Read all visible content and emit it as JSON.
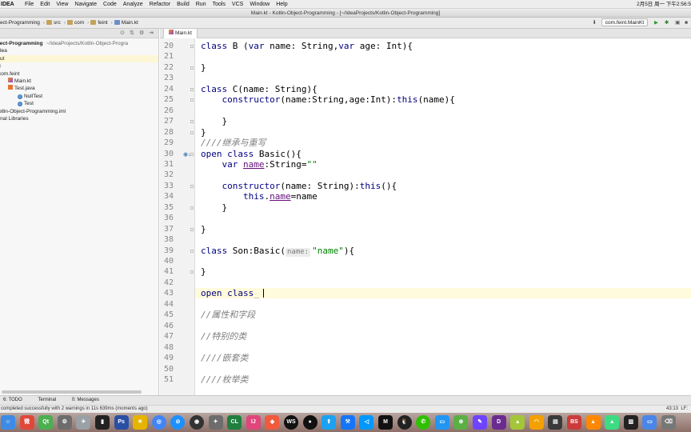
{
  "menubar": {
    "app": "IDEA",
    "items": [
      "File",
      "Edit",
      "View",
      "Navigate",
      "Code",
      "Analyze",
      "Refactor",
      "Build",
      "Run",
      "Tools",
      "VCS",
      "Window",
      "Help"
    ],
    "clock": "2月5日 周一 下午2:56:5"
  },
  "window": {
    "title": "Main.kt - Kotlin-Object-Programming - [~/IdeaProjects/Kotlin-Object-Programming]"
  },
  "navbar": {
    "crumbs": [
      "ect-Programming",
      "src",
      "com",
      "feint",
      "Main.kt"
    ],
    "run_config": "com.feint.MainKt"
  },
  "project": {
    "items": [
      {
        "label": "ject-Programming",
        "extra": "~/IdeaProjects/Kotlin-Object-Progra",
        "kind": "root",
        "bold": true
      },
      {
        "label": "dea",
        "kind": "folder"
      },
      {
        "label": "ut",
        "kind": "folder",
        "selected": true
      },
      {
        "label": "c",
        "kind": "folder"
      },
      {
        "label": "com.feint",
        "kind": "package"
      },
      {
        "label": "Main.kt",
        "kind": "kotlin"
      },
      {
        "label": "Test.java",
        "kind": "java"
      },
      {
        "label": "NullTest",
        "kind": "class"
      },
      {
        "label": "Test",
        "kind": "class"
      },
      {
        "label": "otlin-Object-Programming.iml",
        "kind": "file"
      },
      {
        "label": "rnal Libraries",
        "kind": "lib"
      }
    ]
  },
  "editor": {
    "tab": "Main.kt",
    "current_line": 43,
    "lines": [
      {
        "n": 20,
        "code": [
          {
            "t": "class ",
            "c": "kw"
          },
          {
            "t": "B ("
          },
          {
            "t": "var ",
            "c": "kw"
          },
          {
            "t": "name: String,"
          },
          {
            "t": "var ",
            "c": "kw"
          },
          {
            "t": "age: Int){"
          }
        ]
      },
      {
        "n": 21,
        "code": []
      },
      {
        "n": 22,
        "code": [
          {
            "t": "}"
          }
        ]
      },
      {
        "n": 23,
        "code": []
      },
      {
        "n": 24,
        "code": [
          {
            "t": "class ",
            "c": "kw"
          },
          {
            "t": "C(name: String){"
          }
        ]
      },
      {
        "n": 25,
        "code": [
          {
            "t": "    "
          },
          {
            "t": "constructor",
            "c": "kw"
          },
          {
            "t": "(name:String,age:Int):"
          },
          {
            "t": "this",
            "c": "kw"
          },
          {
            "t": "(name){"
          }
        ]
      },
      {
        "n": 26,
        "code": []
      },
      {
        "n": 27,
        "code": [
          {
            "t": "    }"
          }
        ]
      },
      {
        "n": 28,
        "code": [
          {
            "t": "}"
          }
        ]
      },
      {
        "n": 29,
        "code": [
          {
            "t": "////继承与重写",
            "c": "cm"
          }
        ]
      },
      {
        "n": 30,
        "code": [
          {
            "t": "open class ",
            "c": "kw"
          },
          {
            "t": "Basic(){"
          }
        ]
      },
      {
        "n": 31,
        "code": [
          {
            "t": "    "
          },
          {
            "t": "var ",
            "c": "kw"
          },
          {
            "t": "name",
            "c": "prop"
          },
          {
            "t": ":String="
          },
          {
            "t": "\"\"",
            "c": "str"
          }
        ]
      },
      {
        "n": 32,
        "code": []
      },
      {
        "n": 33,
        "code": [
          {
            "t": "    "
          },
          {
            "t": "constructor",
            "c": "kw"
          },
          {
            "t": "(name: String):"
          },
          {
            "t": "this",
            "c": "kw"
          },
          {
            "t": "(){"
          }
        ]
      },
      {
        "n": 34,
        "code": [
          {
            "t": "        "
          },
          {
            "t": "this",
            "c": "kw"
          },
          {
            "t": "."
          },
          {
            "t": "name",
            "c": "prop"
          },
          {
            "t": "=name"
          }
        ]
      },
      {
        "n": 35,
        "code": [
          {
            "t": "    }"
          }
        ]
      },
      {
        "n": 36,
        "code": []
      },
      {
        "n": 37,
        "code": [
          {
            "t": "}"
          }
        ]
      },
      {
        "n": 38,
        "code": []
      },
      {
        "n": 39,
        "code": [
          {
            "t": "class ",
            "c": "kw"
          },
          {
            "t": "Son:Basic("
          },
          {
            "t": "name:",
            "c": "hint"
          },
          {
            "t": "\"name\"",
            "c": "str"
          },
          {
            "t": "){"
          }
        ]
      },
      {
        "n": 40,
        "code": []
      },
      {
        "n": 41,
        "code": [
          {
            "t": "}"
          }
        ]
      },
      {
        "n": 42,
        "code": []
      },
      {
        "n": 43,
        "code": [
          {
            "t": "open class",
            "c": "kw"
          },
          {
            "t": "_",
            "c": "cm"
          }
        ],
        "caret": true
      },
      {
        "n": 44,
        "code": []
      },
      {
        "n": 45,
        "code": [
          {
            "t": "//属性和字段",
            "c": "cm"
          }
        ]
      },
      {
        "n": 46,
        "code": []
      },
      {
        "n": 47,
        "code": [
          {
            "t": "//特别的类",
            "c": "cm"
          }
        ]
      },
      {
        "n": 48,
        "code": []
      },
      {
        "n": 49,
        "code": [
          {
            "t": "////嵌套类",
            "c": "cm"
          }
        ]
      },
      {
        "n": 50,
        "code": []
      },
      {
        "n": 51,
        "code": [
          {
            "t": "////枚举类",
            "c": "cm"
          }
        ]
      }
    ]
  },
  "toolwindows": [
    "6: TODO",
    "Terminal",
    "0: Messages"
  ],
  "status": {
    "message": "completed successfully with 2 warnings in 11s 639ms (moments ago)",
    "position": "43:13",
    "lf": "LF:"
  },
  "dock": [
    "finder-icon",
    "app-icon",
    "qt-icon",
    "system-prefs-icon",
    "rocket-icon",
    "terminal-icon",
    "photoshop-icon",
    "tool-icon",
    "chrome-icon",
    "safari-icon",
    "dvd-icon",
    "launcher-icon",
    "clion-icon",
    "intellij-icon",
    "ruby-icon",
    "webstorm-icon",
    "github-icon",
    "app-upload-icon",
    "xcode-icon",
    "vscode-icon",
    "markdown-icon",
    "qq-icon",
    "wechat-icon",
    "screenshot-icon",
    "maps-icon",
    "pen-icon",
    "dash-icon",
    "android-icon",
    "wifi-icon",
    "network-icon",
    "bluestack-icon",
    "vlc-icon",
    "android-studio-icon",
    "activity-monitor-icon",
    "slides-icon",
    "trash-icon"
  ],
  "dock_colors": [
    "#3d8be6",
    "#e0483a",
    "#4caf50",
    "#6d6d6d",
    "#9aa0a6",
    "#222",
    "#2b4fa3",
    "#e6b400",
    "#4285f4",
    "#1e90ff",
    "#333",
    "#6d6d6d",
    "#1f7f3f",
    "#e0457b",
    "#f25a3d",
    "#111",
    "#111",
    "#1da1f2",
    "#1575f9",
    "#0098ff",
    "#111",
    "#222",
    "#2dc100",
    "#2196f3",
    "#5ab045",
    "#6e44ff",
    "#6b2b91",
    "#a4c639",
    "#f4a000",
    "#3a3a3a",
    "#cc3b3b",
    "#ff8800",
    "#3ddc84",
    "#222",
    "#4a86e8",
    "#777"
  ]
}
